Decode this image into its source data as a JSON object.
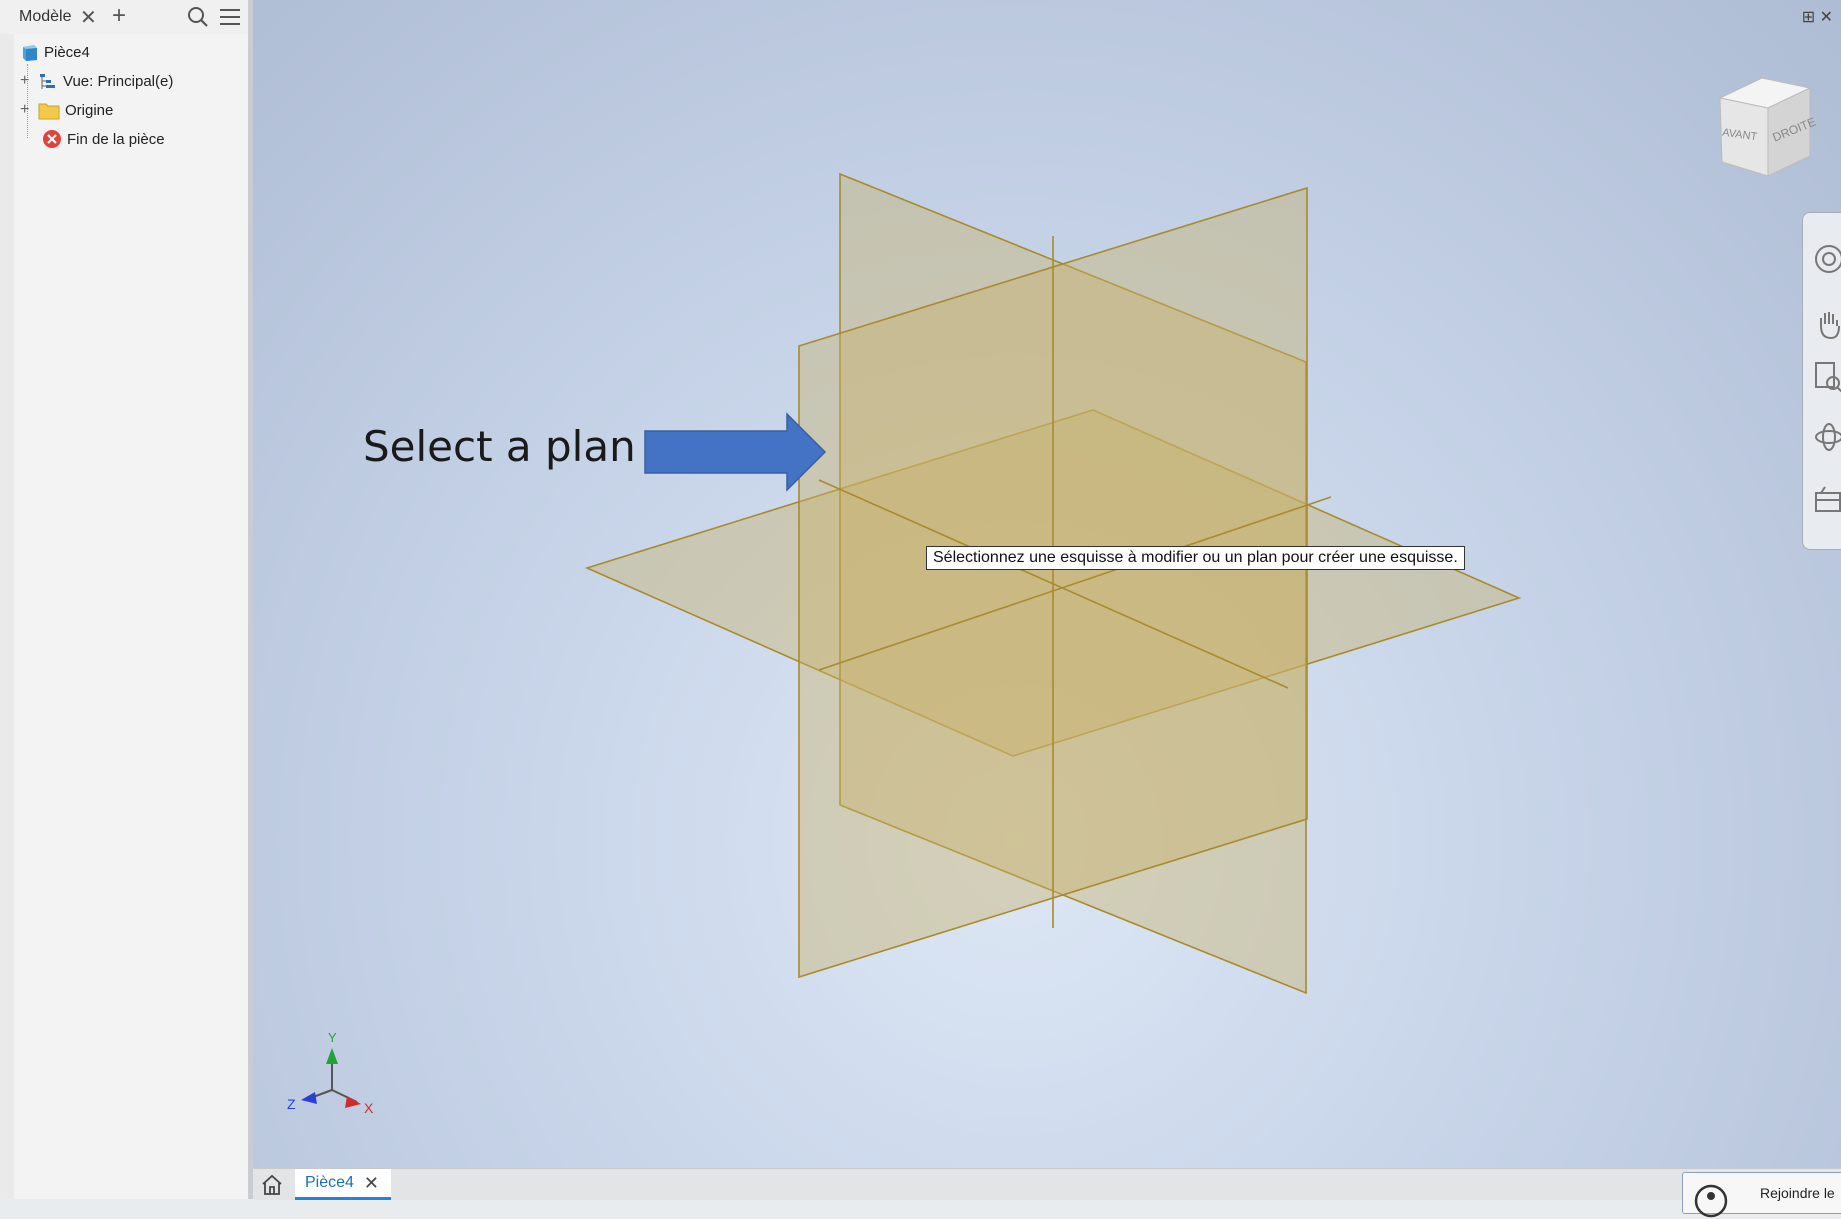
{
  "browser": {
    "tab_title": "Modèle",
    "tree": [
      {
        "label": "Pièce4"
      },
      {
        "label": "Vue: Principal(e)"
      },
      {
        "label": "Origine"
      },
      {
        "label": "Fin de la pièce"
      }
    ]
  },
  "viewport": {
    "annotation": "Select a plan",
    "tooltip": "Sélectionnez une esquisse à modifier ou un plan pour créer une esquisse.",
    "viewcube": {
      "front": "AVANT",
      "right": "DROITE"
    },
    "axes": {
      "x": "X",
      "y": "Y",
      "z": "Z"
    }
  },
  "tabs": {
    "document": "Pièce4",
    "join": "Rejoindre le"
  },
  "colors": {
    "plane_fill": "#c9b06a",
    "plane_stroke": "#a98a2e",
    "arrow": "#4472c4",
    "axis_x": "#d22b2b",
    "axis_y": "#22a33a",
    "axis_z": "#2b3fd2"
  }
}
